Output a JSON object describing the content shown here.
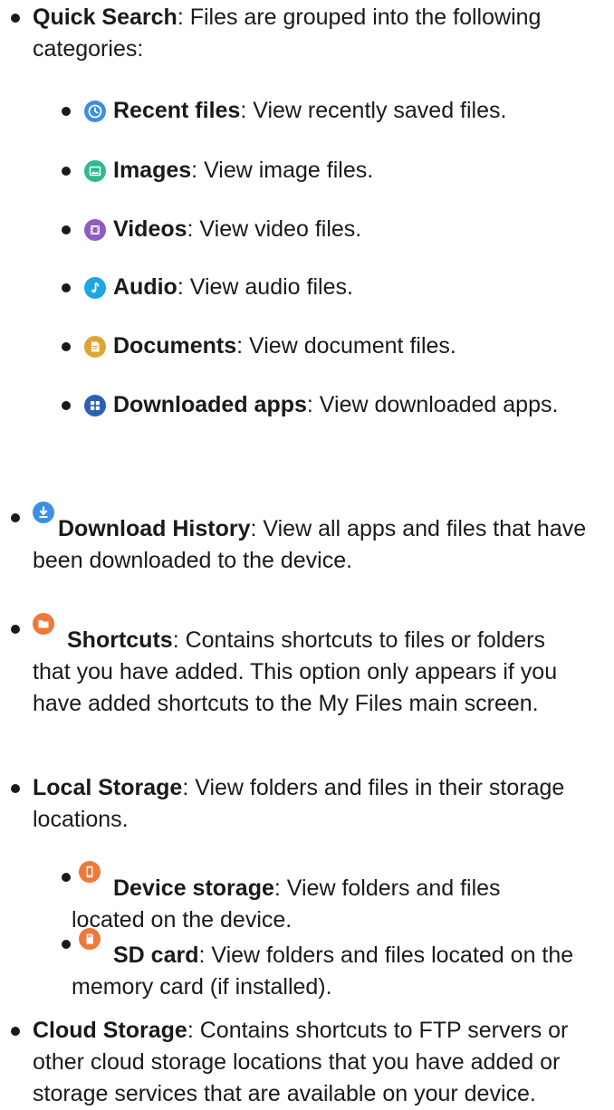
{
  "colors": {
    "text": "#1a1a1a",
    "recent": "#3d8fe0",
    "images": "#2fb98f",
    "videos": "#8e5cc2",
    "audio": "#1fa6e0",
    "documents": "#e0a531",
    "apps": "#2f5fb3",
    "download": "#3d8fe0",
    "shortcuts": "#f07838",
    "device": "#f07838",
    "sdcard": "#f07838"
  },
  "quick_search": {
    "title": "Quick Search",
    "desc": ": Files are grouped into the following categories:",
    "items": [
      {
        "icon": "clock-icon",
        "title": "Recent files",
        "desc": ": View recently saved files."
      },
      {
        "icon": "image-icon",
        "title": "Images",
        "desc": ": View image files."
      },
      {
        "icon": "video-icon",
        "title": "Videos",
        "desc": ": View video files."
      },
      {
        "icon": "music-note-icon",
        "title": "Audio",
        "desc": ": View audio files."
      },
      {
        "icon": "document-icon",
        "title": "Documents",
        "desc": ": View document files."
      },
      {
        "icon": "apps-icon",
        "title": "Downloaded apps",
        "desc": ": View downloaded apps."
      }
    ]
  },
  "download_history": {
    "icon": "download-icon",
    "title": "Download History",
    "desc": ": View all apps and files that have been downloaded to the device."
  },
  "shortcuts": {
    "icon": "folder-icon",
    "title": "Shortcuts",
    "desc": ": Contains shortcuts to files or folders that you have added. This option only appears if you have added shortcuts to the My Files main screen."
  },
  "local_storage": {
    "title": "Local Storage",
    "desc": ": View folders and files in their storage locations.",
    "items": [
      {
        "icon": "phone-icon",
        "title": "Device storage",
        "desc": ": View folders and files located on the device."
      },
      {
        "icon": "sd-card-icon",
        "title": "SD card",
        "desc": ": View folders and files located on the memory card (if installed)."
      }
    ]
  },
  "cloud_storage": {
    "title": "Cloud Storage",
    "desc": ": Contains shortcuts to FTP servers or other cloud storage locations that you have added or storage services that are available on your device."
  }
}
